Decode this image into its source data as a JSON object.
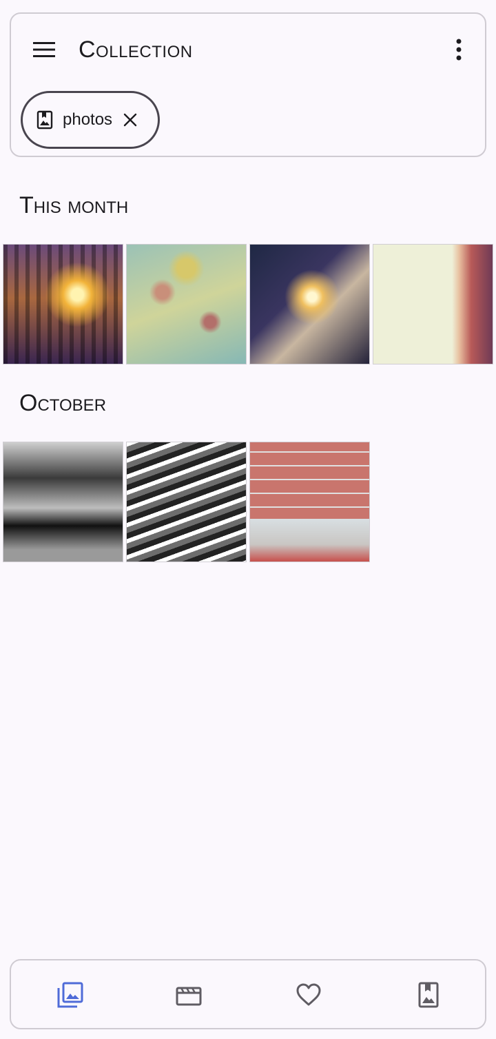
{
  "header": {
    "title": "Collection",
    "menu_icon": "hamburger-menu-icon",
    "more_icon": "more-vert-icon"
  },
  "filter_chip": {
    "label": "photos",
    "icon": "bookmark-photo-icon",
    "close_icon": "close-icon"
  },
  "sections": [
    {
      "title": "This month",
      "photos": [
        "photo-1",
        "photo-2",
        "photo-3",
        "photo-4"
      ]
    },
    {
      "title": "October",
      "photos": [
        "photo-5",
        "photo-6",
        "photo-7"
      ]
    }
  ],
  "bottom_nav": {
    "items": [
      {
        "name": "photos",
        "icon": "photo-library-icon",
        "active": true
      },
      {
        "name": "videos",
        "icon": "movie-icon",
        "active": false
      },
      {
        "name": "favorites",
        "icon": "heart-icon",
        "active": false
      },
      {
        "name": "collections",
        "icon": "bookmark-photo-icon",
        "active": false
      }
    ],
    "active_color": "#4f6bd8",
    "inactive_color": "#5f5c63"
  }
}
